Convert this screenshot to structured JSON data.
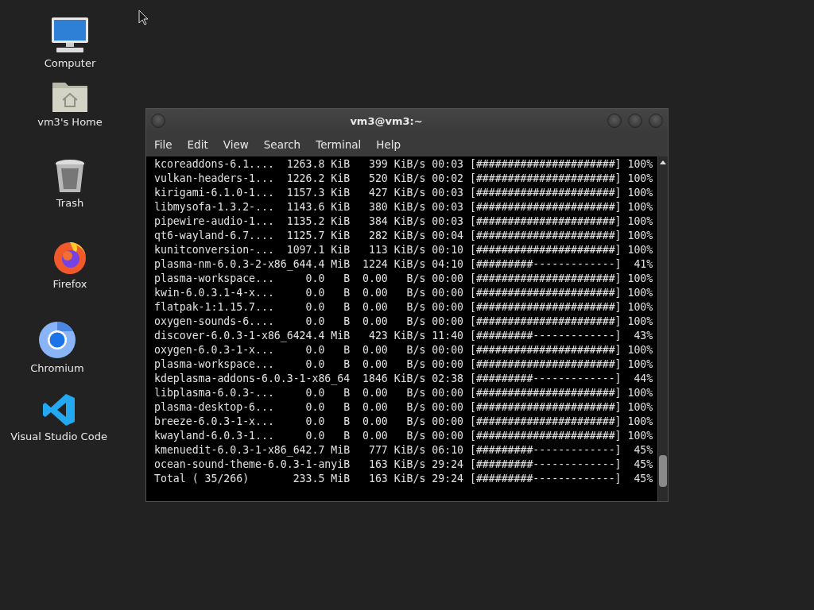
{
  "desktop_icons": [
    {
      "label": "Computer"
    },
    {
      "label": "vm3's Home"
    },
    {
      "label": "Trash"
    },
    {
      "label": "Firefox"
    },
    {
      "label": "Chromium"
    },
    {
      "label": "Visual Studio Code"
    }
  ],
  "window": {
    "title": "vm3@vm3:~"
  },
  "menu": [
    "File",
    "Edit",
    "View",
    "Search",
    "Terminal",
    "Help"
  ],
  "terminal_lines": [
    "kcoreaddons-6.1....  1263.8 KiB   399 KiB/s 00:03 [######################] 100%",
    "vulkan-headers-1...  1226.2 KiB   520 KiB/s 00:02 [######################] 100%",
    "kirigami-6.1.0-1...  1157.3 KiB   427 KiB/s 00:03 [######################] 100%",
    "libmysofa-1.3.2-...  1143.6 KiB   380 KiB/s 00:03 [######################] 100%",
    "pipewire-audio-1...  1135.2 KiB   384 KiB/s 00:03 [######################] 100%",
    "qt6-wayland-6.7....  1125.7 KiB   282 KiB/s 00:04 [######################] 100%",
    "kunitconversion-...  1097.1 KiB   113 KiB/s 00:10 [######################] 100%",
    "plasma-nm-6.0.3-2-x86_644.4 MiB  1224 KiB/s 04:10 [#########-------------]  41%",
    "plasma-workspace...     0.0   B  0.00   B/s 00:00 [######################] 100%",
    "kwin-6.0.3.1-4-x...     0.0   B  0.00   B/s 00:00 [######################] 100%",
    "flatpak-1:1.15.7...     0.0   B  0.00   B/s 00:00 [######################] 100%",
    "oxygen-sounds-6....     0.0   B  0.00   B/s 00:00 [######################] 100%",
    "discover-6.0.3-1-x86_6424.4 MiB   423 KiB/s 11:40 [#########-------------]  43%",
    "oxygen-6.0.3-1-x...     0.0   B  0.00   B/s 00:00 [######################] 100%",
    "plasma-workspace...     0.0   B  0.00   B/s 00:00 [######################] 100%",
    "kdeplasma-addons-6.0.3-1-x86_64  1846 KiB/s 02:38 [#########-------------]  44%",
    "libplasma-6.0.3-...     0.0   B  0.00   B/s 00:00 [######################] 100%",
    "plasma-desktop-6...     0.0   B  0.00   B/s 00:00 [######################] 100%",
    "breeze-6.0.3-1-x...     0.0   B  0.00   B/s 00:00 [######################] 100%",
    "kwayland-6.0.3-1...     0.0   B  0.00   B/s 00:00 [######################] 100%",
    "kmenuedit-6.0.3-1-x86_642.7 MiB   777 KiB/s 06:10 [#########-------------]  45%",
    "ocean-sound-theme-6.0.3-1-anyiB   163 KiB/s 29:24 [#########-------------]  45%",
    "Total ( 35/266)       233.5 MiB   163 KiB/s 29:24 [#########-------------]  45%"
  ]
}
